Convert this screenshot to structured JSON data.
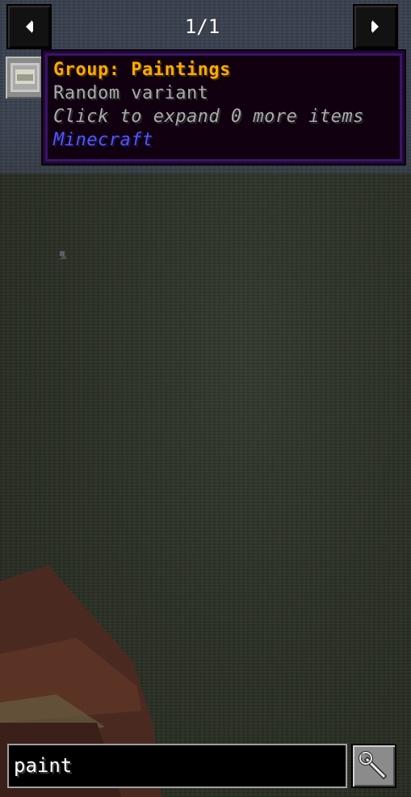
{
  "header": {
    "page_indicator": "1/1",
    "prev_icon": "arrow-left-icon",
    "next_icon": "arrow-right-icon"
  },
  "item_slot": {
    "icon": "painting-icon"
  },
  "tooltip": {
    "title": "Group: Paintings",
    "description": "Random variant",
    "hint": "Click to expand 0 more items",
    "mod_name": "Minecraft",
    "colors": {
      "title": "#ffaa00",
      "description": "#aaaaaa",
      "mod": "#5555ff"
    }
  },
  "search": {
    "value": "paint"
  },
  "config_button": {
    "icon": "wrench-icon"
  }
}
